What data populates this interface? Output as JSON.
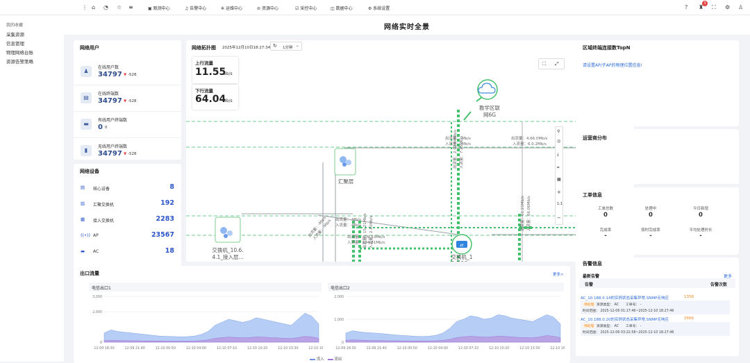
{
  "topnav": {
    "items": [
      {
        "label": "观测中心",
        "icon": "monitor-icon"
      },
      {
        "label": "告警中心",
        "icon": "bell-icon"
      },
      {
        "label": "运维中心",
        "icon": "gear-icon"
      },
      {
        "label": "资源中心",
        "icon": "database-icon"
      },
      {
        "label": "采控中心",
        "icon": "control-icon"
      },
      {
        "label": "数据中心",
        "icon": "data-icon"
      },
      {
        "label": "系统设置",
        "icon": "settings-icon"
      }
    ],
    "badge": "3"
  },
  "sidebar": {
    "title": "我的收藏",
    "items": [
      "采集资源",
      "信息管理",
      "物理网络台账",
      "资源告警策略"
    ]
  },
  "page": {
    "title": "网络实时全景"
  },
  "users": {
    "title": "网络用户",
    "rows": [
      {
        "label": "在线用户数",
        "value": "34797",
        "delta": "-528"
      },
      {
        "label": "在线终端数",
        "value": "34797",
        "delta": "-528"
      },
      {
        "label": "有线用户终端数",
        "value": "0",
        "delta": "0"
      },
      {
        "label": "无线用户终端数",
        "value": "34797",
        "delta": "-528"
      }
    ]
  },
  "devices": {
    "title": "网络设备",
    "rows": [
      {
        "label": "核心设备",
        "value": "8"
      },
      {
        "label": "汇聚交换机",
        "value": "192"
      },
      {
        "label": "接入交换机",
        "value": "2283"
      },
      {
        "label": "AP",
        "value": "23567"
      },
      {
        "label": "AC",
        "value": "18"
      }
    ]
  },
  "topology": {
    "title": "网络拓扑图",
    "time": "2025年12月10日18:27:34",
    "refresh": "1分钟",
    "up_label": "上行流量",
    "up_value": "11.55",
    "up_unit": "Gb/s",
    "down_label": "下行流量",
    "down_value": "64.04",
    "down_unit": "Gb/s",
    "node_cloud": "教学区联\n网6G",
    "node_agg": "汇聚层",
    "node_sw1": "交换机_10.6.\n4.1_接入层...",
    "node_sw2": "交换机_1\n0.6.10...",
    "edge_labels": [
      "出流量：-Mb/s",
      "入流量：-Mb/s",
      "出流量：409.53Mb/s",
      "入流量：194.81Mb/s",
      "出流量：4.66.0Mb/s",
      "入流量：6.0.2Mb/s",
      "出流量：61.21Mb/s",
      "入流量：66.06Mb/s",
      "出流量：15.21Mb/s",
      "入流量：2.92.44Mb/s"
    ],
    "tools": [
      "全屏",
      "放大",
      "缩小"
    ]
  },
  "topn": {
    "title": "区域终端连接数TopN",
    "tip": "请设置AP/子AP的物理位置信息!"
  },
  "carrier": {
    "title": "运营商分布"
  },
  "workorder": {
    "title": "工单信息",
    "r1": [
      {
        "label": "工单总数",
        "value": "0"
      },
      {
        "label": "处理中",
        "value": "0"
      },
      {
        "label": "今日新增",
        "value": "0"
      }
    ],
    "r2": [
      {
        "label": "完成率",
        "value": "-"
      },
      {
        "label": "按时完成率",
        "value": "-"
      },
      {
        "label": "平均处理时长",
        "value": "-"
      }
    ]
  },
  "alarm": {
    "title": "告警信息",
    "sub": "最新告警",
    "more": "更多",
    "col1": "告警",
    "col2": "告警次数",
    "items": [
      {
        "text": "AC_10.188.0.14的实例状态采集异常,SNMP无响应",
        "count": "1358",
        "tag": "待处理",
        "type": "资源类型： AC",
        "no": "工单号： -",
        "time": "时间范围： 2025-12-06 01:17:46~2025-12-10 18:27:46"
      },
      {
        "text": "AC_10.188.0.20的实例状态采集异常,SNMP无响应",
        "count": "2666",
        "tag": "待处理",
        "type": "资源类型： AC",
        "no": "工单号： -",
        "time": "时间范围： 2025-12-06 03:22:58~2025-12-10 18:27:46"
      }
    ]
  },
  "egress": {
    "title": "出口流量",
    "more": "更多>"
  },
  "chart_data": [
    {
      "type": "area",
      "title": "电信出口1",
      "x": [
        "12-09 18:30",
        "12-09 21:40",
        "12-10 00:50",
        "12-10 04:00",
        "12-10 07:10",
        "12-10 10:20",
        "12-10 13:30",
        "12-10 16:40"
      ],
      "yticks": [
        0,
        2000,
        3000
      ],
      "ylim": [
        0,
        3000
      ],
      "series": [
        {
          "name": "流入",
          "color": "#9dbcf2",
          "values": [
            600,
            800,
            700,
            650,
            600,
            550,
            500,
            450,
            400,
            380,
            370,
            350,
            360,
            400,
            500,
            700,
            1100,
            1300,
            1500,
            1400,
            1300,
            1400,
            1600,
            1500,
            1400,
            1300,
            1200,
            1100,
            1500,
            1900,
            1700,
            1200
          ]
        },
        {
          "name": "流出",
          "color": "#b99be0",
          "values": [
            100,
            120,
            110,
            100,
            90,
            90,
            80,
            80,
            80,
            70,
            70,
            70,
            70,
            80,
            100,
            150,
            250,
            300,
            330,
            310,
            290,
            300,
            350,
            330,
            300,
            280,
            260,
            240,
            300,
            380,
            340,
            250
          ]
        }
      ],
      "legend": "bottom"
    },
    {
      "type": "area",
      "title": "电信出口2",
      "x": [
        "12-09 18:30",
        "12-09 21:40",
        "12-10 00:50",
        "12-10 04:00",
        "12-10 07:10",
        "12-10 10:20",
        "12-10 13:30",
        "12-10 16:40"
      ],
      "yticks": [
        0,
        1000,
        2000
      ],
      "ylim": [
        0,
        2000
      ],
      "series": [
        {
          "name": "流入",
          "color": "#9dbcf2",
          "values": [
            400,
            500,
            450,
            420,
            400,
            380,
            350,
            320,
            300,
            280,
            260,
            250,
            260,
            300,
            400,
            600,
            900,
            1000,
            1150,
            1100,
            1000,
            1050,
            1200,
            1150,
            1050,
            1000,
            950,
            900,
            1050,
            1200,
            1100,
            800
          ]
        },
        {
          "name": "流出",
          "color": "#b99be0",
          "values": [
            80,
            100,
            90,
            80,
            70,
            70,
            60,
            60,
            60,
            55,
            55,
            55,
            55,
            60,
            80,
            120,
            200,
            230,
            260,
            240,
            220,
            230,
            270,
            250,
            230,
            210,
            200,
            190,
            230,
            290,
            260,
            190
          ]
        }
      ],
      "legend": "bottom"
    }
  ]
}
